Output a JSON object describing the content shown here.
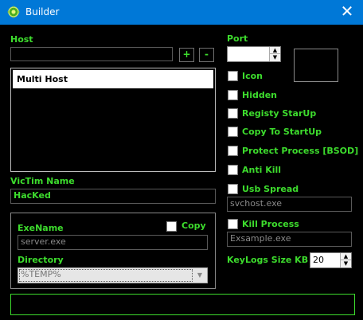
{
  "window": {
    "title": "Builder",
    "close_glyph": "✕",
    "app_icon": "green-gear-icon"
  },
  "host": {
    "label": "Host",
    "value": "",
    "add_label": "+",
    "remove_label": "-",
    "list_items": [
      "Multi Host"
    ]
  },
  "port": {
    "label": "Port",
    "value": ""
  },
  "options": {
    "icon": "Icon",
    "hidden": "Hidden",
    "registry_startup": "Registy StarUp",
    "copy_to_startup": "Copy To StartUp",
    "protect_process": "Protect Process [BSOD]",
    "anti_kill": "Anti Kill",
    "usb_spread": "Usb Spread",
    "usb_spread_value": "svchost.exe",
    "kill_process": "Kill Process",
    "kill_process_value": "Exsample.exe"
  },
  "victim": {
    "label": "VicTim Name",
    "value": "HacKed"
  },
  "exe": {
    "name_label": "ExeName",
    "name_value": "server.exe",
    "copy_label": "Copy",
    "directory_label": "Directory",
    "directory_value": "%TEMP%"
  },
  "keylogs": {
    "label": "KeyLogs Size KB",
    "value": "20"
  },
  "colors": {
    "accent": "#3ddc2d",
    "titlebar": "#0078d7",
    "background": "#000000"
  }
}
